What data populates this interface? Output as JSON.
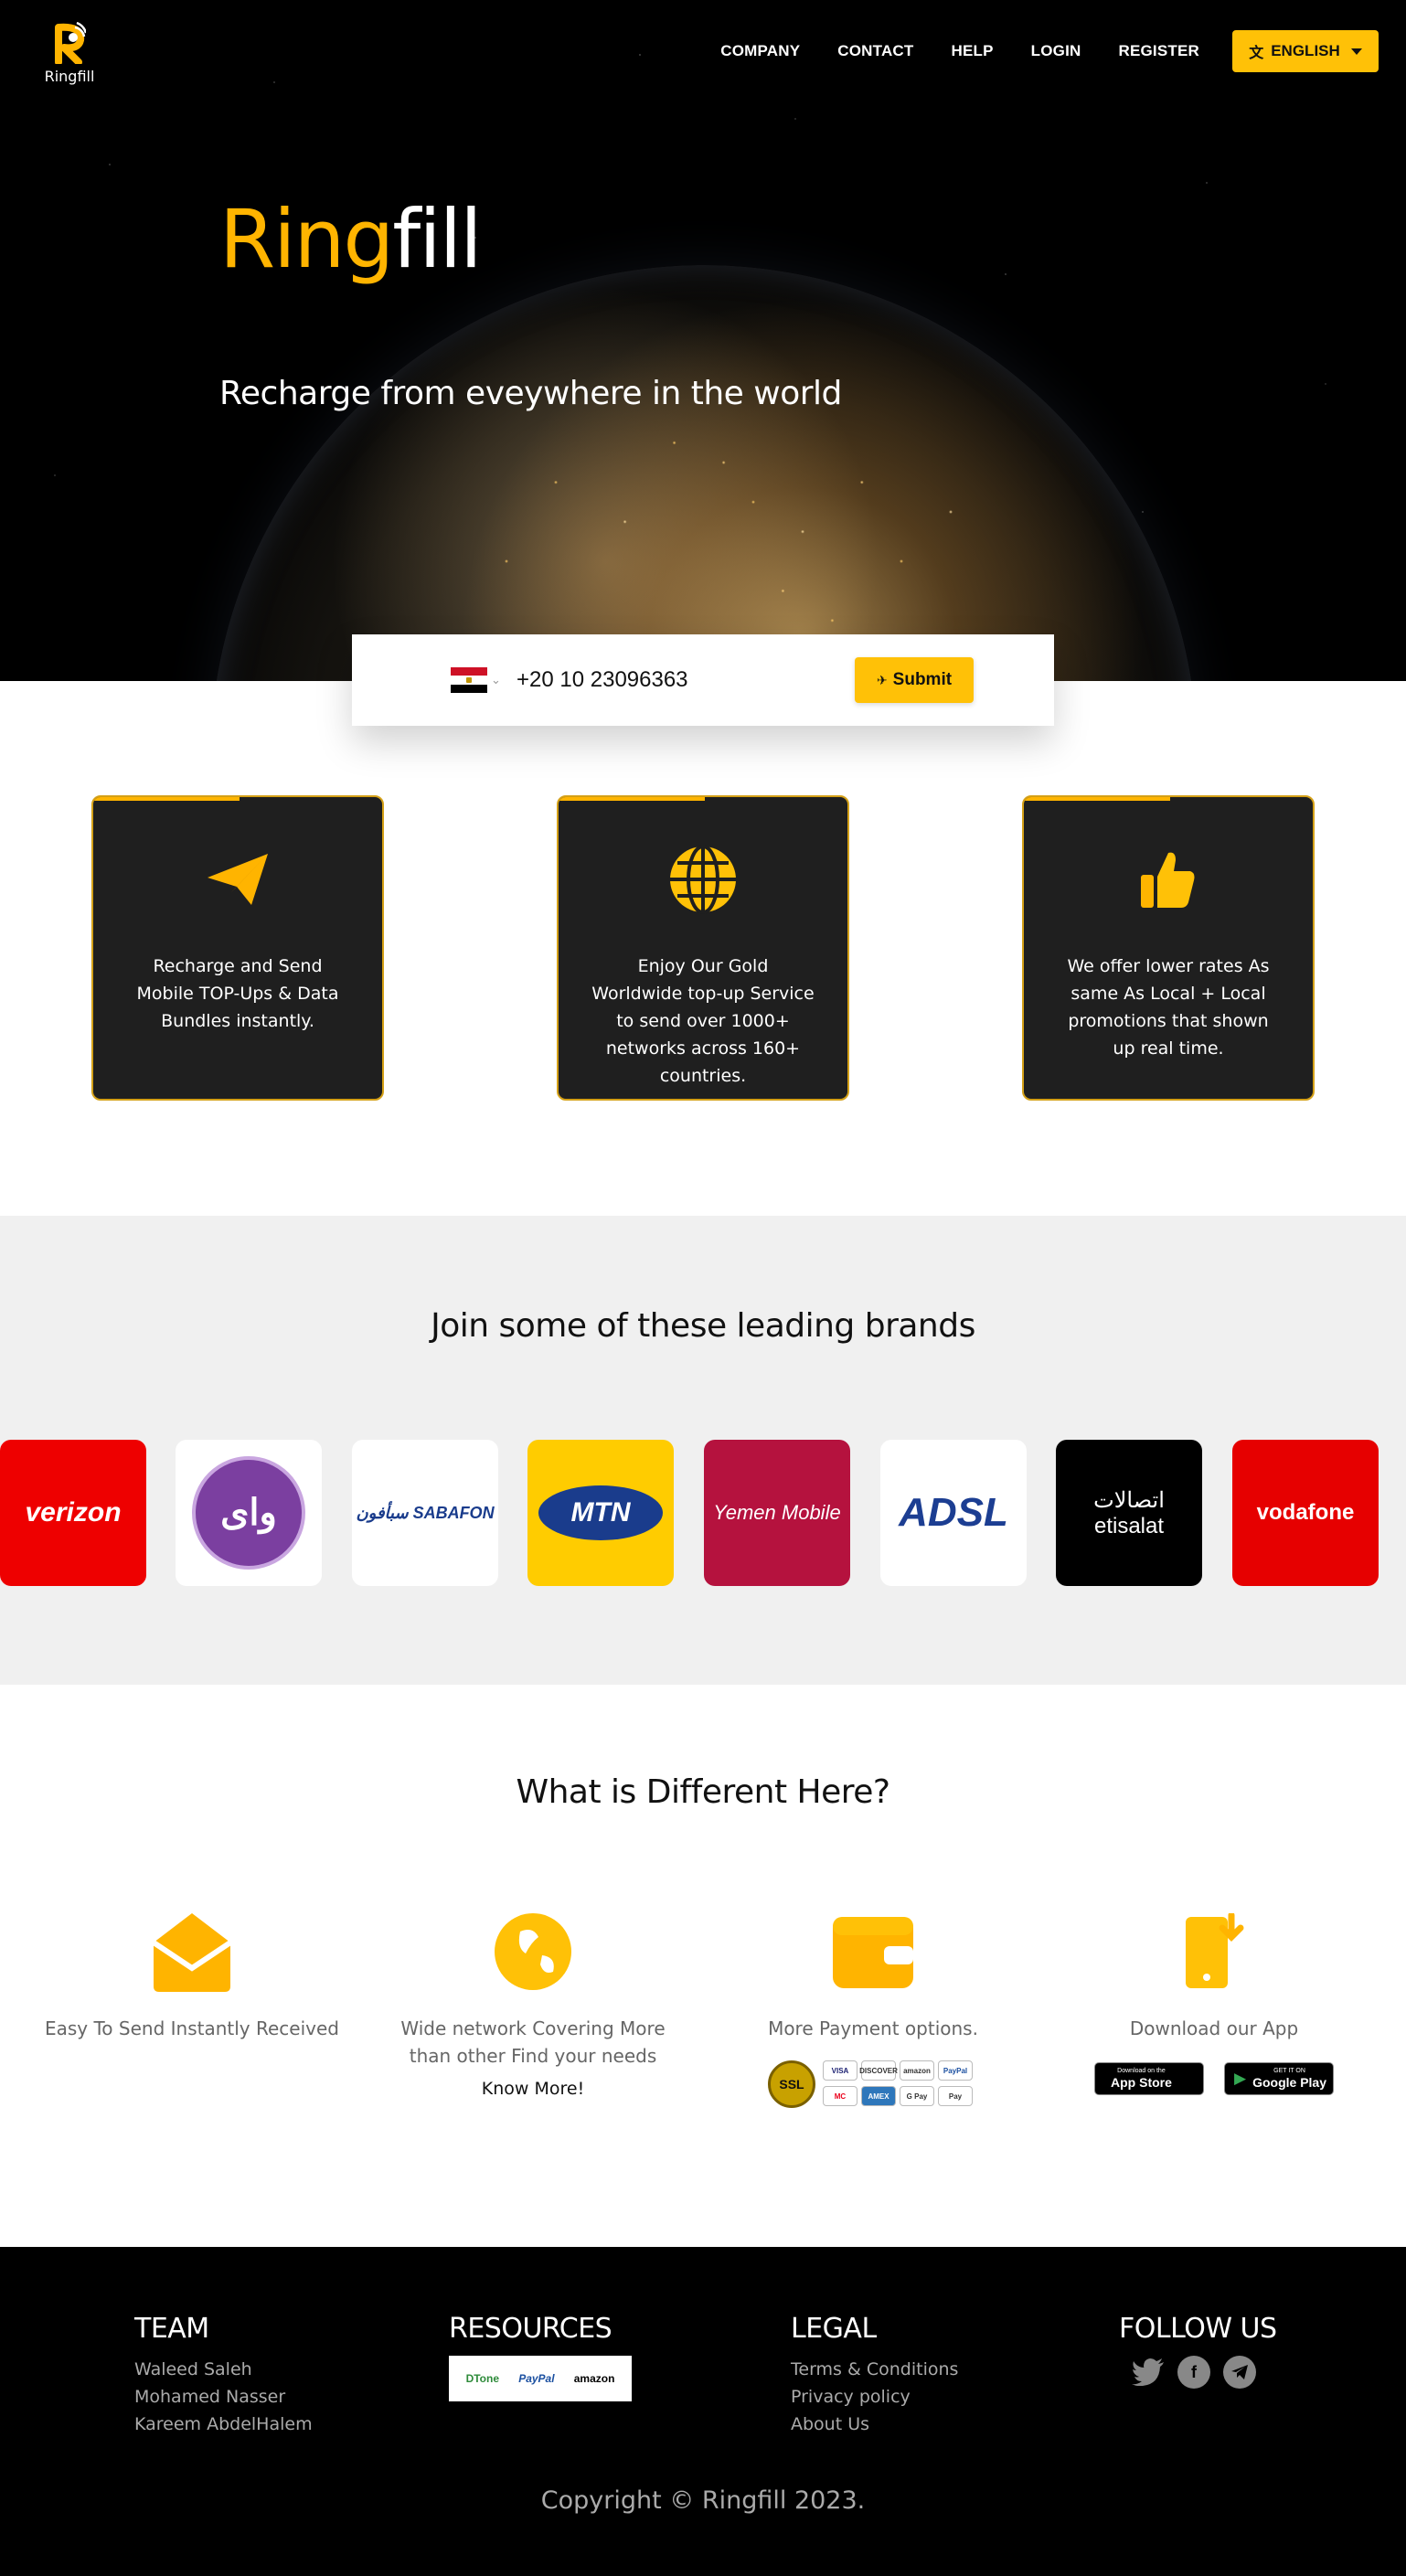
{
  "nav": {
    "logo_text": "Ringfill",
    "links": [
      "COMPANY",
      "CONTACT",
      "HELP",
      "LOGIN",
      "REGISTER"
    ],
    "language": "ENGLISH"
  },
  "hero": {
    "title_part1": "Ring",
    "title_part2": "fill",
    "subtitle": "Recharge from eveywhere in the world"
  },
  "phone_form": {
    "country": "Egypt",
    "phone_value": "+20 10 23096363",
    "submit_label": "Submit"
  },
  "features": [
    {
      "icon": "paper-plane-icon",
      "text": "Recharge and Send Mobile TOP-Ups & Data Bundles instantly."
    },
    {
      "icon": "globe-icon",
      "text": "Enjoy Our Gold Worldwide top-up Service to send over 1000+ networks across 160+ countries."
    },
    {
      "icon": "thumbs-up-icon",
      "text": "We offer lower rates As same As Local + Local promotions that shown up real time."
    }
  ],
  "brands": {
    "title": "Join some of these leading brands",
    "items": [
      {
        "name": "verizon",
        "bg": "#ee0000",
        "color": "#ffffff"
      },
      {
        "name": "وای",
        "bg": "#ffffff",
        "color": "#7b3fa0"
      },
      {
        "name": "سبأفون SABAFON",
        "bg": "#ffffff",
        "color": "#1a3c8c"
      },
      {
        "name": "MTN",
        "bg": "#ffcc00",
        "color": "#ffffff"
      },
      {
        "name": "Yemen Mobile",
        "bg": "#b5123e",
        "color": "#ffffff"
      },
      {
        "name": "ADSL",
        "bg": "#ffffff",
        "color": "#1c3e92"
      },
      {
        "name": "اتصالات etisalat",
        "bg": "#000000",
        "color": "#ffffff"
      },
      {
        "name": "vodafone",
        "bg": "#e60000",
        "color": "#ffffff"
      }
    ]
  },
  "different": {
    "title": "What is Different Here?",
    "items": [
      {
        "icon": "envelope-open-icon",
        "label": "Easy To Send Instantly Received"
      },
      {
        "icon": "earth-icon",
        "label": "Wide network Covering More than other Find your needs",
        "link": "Know More!"
      },
      {
        "icon": "wallet-icon",
        "label": "More Payment options."
      },
      {
        "icon": "download-app-icon",
        "label": "Download our App"
      }
    ],
    "payment_chips": [
      "VISA",
      "DISCOVER",
      "amazon",
      "PayPal",
      "MC",
      "AMEX",
      "G Pay",
      "Pay"
    ],
    "ssl_label": "SSL",
    "app_store": {
      "small": "Download on the",
      "big": "App Store"
    },
    "google_play": {
      "small": "GET IT ON",
      "big": "Google Play"
    }
  },
  "footer": {
    "team": {
      "title": "TEAM",
      "members": [
        "Waleed Saleh",
        "Mohamed Nasser",
        "Kareem AbdelHalem"
      ]
    },
    "resources": {
      "title": "RESOURCES",
      "partners": [
        "DTone",
        "PayPal",
        "amazon"
      ]
    },
    "legal": {
      "title": "LEGAL",
      "links": [
        "Terms & Conditions",
        "Privacy policy",
        "About Us"
      ]
    },
    "follow": {
      "title": "FOLLOW US",
      "icons": [
        "twitter-icon",
        "facebook-icon",
        "telegram-icon"
      ]
    },
    "copyright": "Copyright © Ringfill 2023."
  },
  "colors": {
    "accent": "#ffc107",
    "brand_orange": "#ffb400",
    "card_bg": "#1f1f1f"
  }
}
